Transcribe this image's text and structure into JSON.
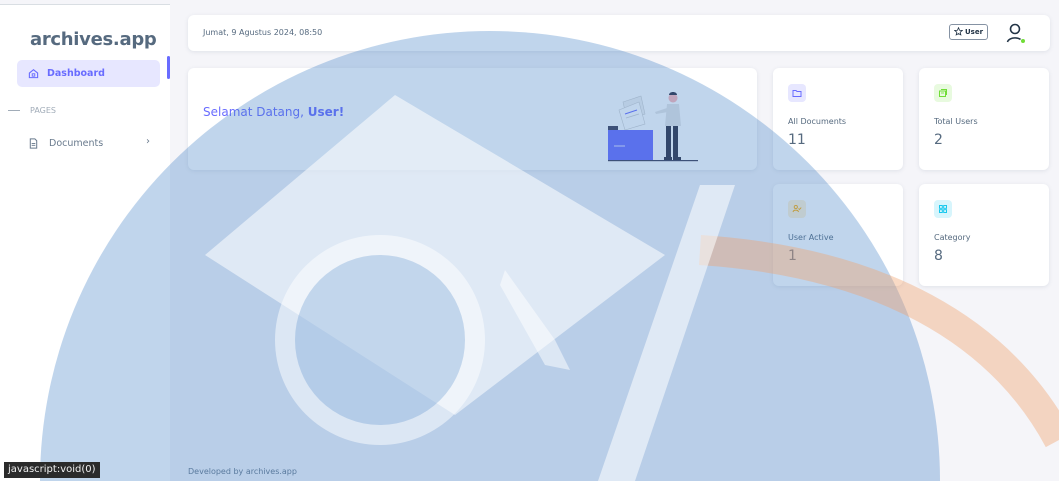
{
  "brand": {
    "part1": "archives.",
    "part2": "app"
  },
  "sidebar": {
    "active_item": {
      "label": "Dashboard",
      "icon": "home-icon"
    },
    "section_label": "PAGES",
    "items": [
      {
        "label": "Documents",
        "icon": "file-icon",
        "chevron": "›"
      }
    ]
  },
  "topbar": {
    "datetime": "Jumat, 9 Agustus 2024, 08:50",
    "user_button_label": "User",
    "user_button_icon": "star-icon"
  },
  "welcome": {
    "greeting": "Selamat Datang, ",
    "name": "User!"
  },
  "stats": [
    {
      "label": "All Documents",
      "value": "11",
      "icon": "folder-icon",
      "color": "#696cff",
      "bg": "#e7e7ff"
    },
    {
      "label": "Total Users",
      "value": "2",
      "icon": "users-icon",
      "color": "#71dd37",
      "bg": "#e8fadf"
    },
    {
      "label": "User Active",
      "value": "1",
      "icon": "user-check-icon",
      "color": "#ffab00",
      "bg": "#fff2d6"
    },
    {
      "label": "Category",
      "value": "8",
      "icon": "grid-icon",
      "color": "#03c3ec",
      "bg": "#d7f5fc"
    }
  ],
  "footer": {
    "text": "Developed by archives.app"
  },
  "status_tooltip": "javascript:void(0)"
}
